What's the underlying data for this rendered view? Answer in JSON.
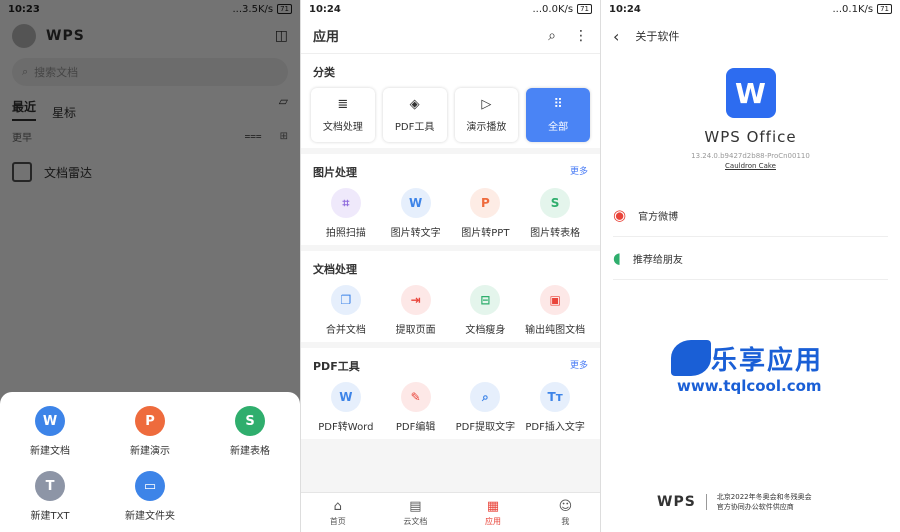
{
  "panel1": {
    "status": {
      "time": "10:23",
      "speed": "...3.5K/s",
      "battery": "71"
    },
    "logo": "WPS",
    "search_placeholder": "搜索文档",
    "tabs": [
      "最近",
      "星标"
    ],
    "section_label": "更早",
    "file_name": "文档雷达",
    "sheet_items": [
      {
        "label": "新建文档",
        "glyph": "W",
        "color": "#3d84e8"
      },
      {
        "label": "新建演示",
        "glyph": "P",
        "color": "#ee6b3d"
      },
      {
        "label": "新建表格",
        "glyph": "S",
        "color": "#2fae6d"
      },
      {
        "label": "新建TXT",
        "glyph": "T",
        "color": "#8d95a6"
      },
      {
        "label": "新建文件夹",
        "glyph": "▭",
        "color": "#3d84e8"
      }
    ]
  },
  "panel2": {
    "status": {
      "time": "10:24",
      "speed": "...0.0K/s",
      "battery": "71"
    },
    "title": "应用",
    "categories_title": "分类",
    "categories": [
      {
        "label": "文档处理",
        "icon": "doc-icon",
        "glyph": "≣"
      },
      {
        "label": "PDF工具",
        "icon": "pdf-icon",
        "glyph": "◈"
      },
      {
        "label": "演示播放",
        "icon": "play-icon",
        "glyph": "▷"
      },
      {
        "label": "全部",
        "icon": "grid-icon",
        "glyph": "⠿"
      }
    ],
    "more_label": "更多",
    "sections": [
      {
        "title": "图片处理",
        "more": true,
        "tools": [
          {
            "label": "拍照扫描",
            "glyph": "⌗",
            "color": "#8e6bdc",
            "bg": "#efe9fb"
          },
          {
            "label": "图片转文字",
            "glyph": "W",
            "color": "#3d84e8",
            "bg": "#e6effc"
          },
          {
            "label": "图片转PPT",
            "glyph": "P",
            "color": "#ee6b3d",
            "bg": "#fdece5"
          },
          {
            "label": "图片转表格",
            "glyph": "S",
            "color": "#2fae6d",
            "bg": "#e4f5ec"
          }
        ]
      },
      {
        "title": "文档处理",
        "more": false,
        "tools": [
          {
            "label": "合并文档",
            "glyph": "❐",
            "color": "#3d84e8",
            "bg": "#e6effc"
          },
          {
            "label": "提取页面",
            "glyph": "⇥",
            "color": "#e9443a",
            "bg": "#fde8e7"
          },
          {
            "label": "文档瘦身",
            "glyph": "⊟",
            "color": "#2fae6d",
            "bg": "#e4f5ec"
          },
          {
            "label": "输出纯图文档",
            "glyph": "▣",
            "color": "#e9443a",
            "bg": "#fde8e7"
          }
        ]
      },
      {
        "title": "PDF工具",
        "more": true,
        "tools": [
          {
            "label": "PDF转Word",
            "glyph": "W",
            "color": "#3d84e8",
            "bg": "#e6effc"
          },
          {
            "label": "PDF编辑",
            "glyph": "✎",
            "color": "#e9443a",
            "bg": "#fde8e7"
          },
          {
            "label": "PDF提取文字",
            "glyph": "⌕",
            "color": "#3d84e8",
            "bg": "#e6effc"
          },
          {
            "label": "PDF插入文字",
            "glyph": "Tт",
            "color": "#3d84e8",
            "bg": "#e6effc"
          }
        ]
      }
    ],
    "nav": [
      {
        "label": "首页",
        "glyph": "⌂"
      },
      {
        "label": "云文档",
        "glyph": "▤"
      },
      {
        "label": "应用",
        "glyph": "▦"
      },
      {
        "label": "我",
        "glyph": "☺"
      }
    ]
  },
  "panel3": {
    "status": {
      "time": "10:24",
      "speed": "...0.1K/s",
      "battery": "71"
    },
    "title": "关于软件",
    "app_name": "WPS Office",
    "version": "13.24.0.b9427d2b88-ProCn00110",
    "build": "Cauldron Cake",
    "menu": [
      {
        "label": "官方微博",
        "icon": "weibo-icon",
        "glyph": "◉",
        "color": "#e9443a"
      },
      {
        "label": "推荐给朋友",
        "icon": "share-icon",
        "glyph": "◖",
        "color": "#2fae6d"
      }
    ],
    "watermark_cn": "乐享应用",
    "watermark_url": "www.tqlcool.com",
    "footer_brand": "WPS",
    "sponsor_line1": "北京2022年冬奥会和冬残奥会",
    "sponsor_line2": "官方协同办公软件供应商"
  }
}
